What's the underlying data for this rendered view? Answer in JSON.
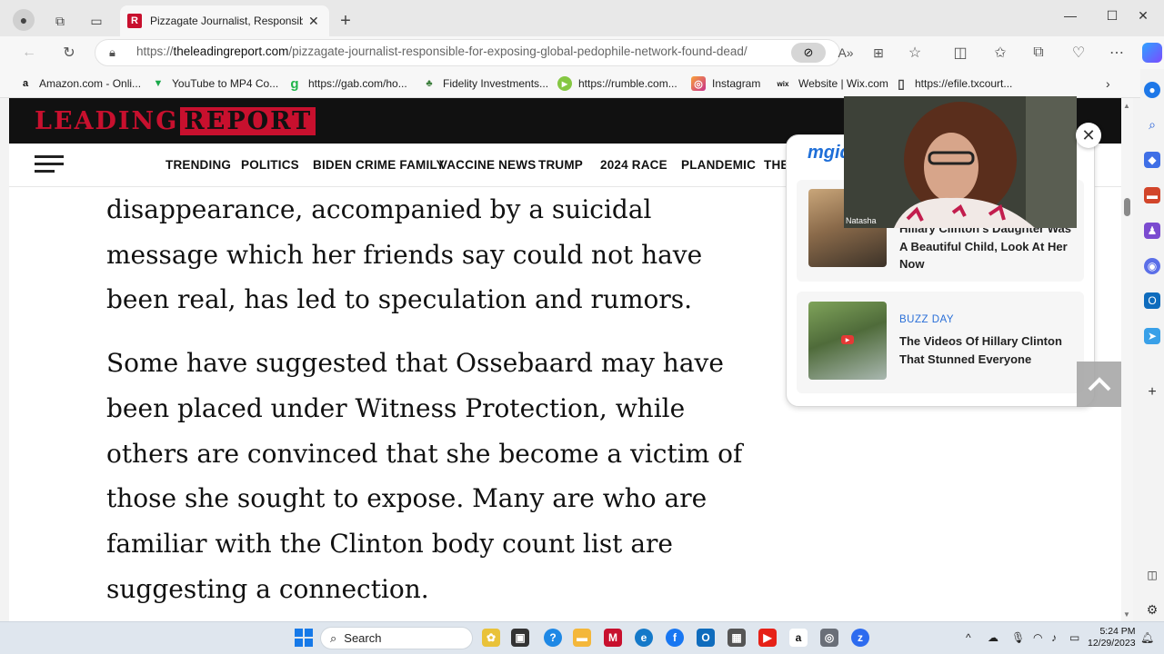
{
  "browser": {
    "tab_title": "Pizzagate Journalist, Responsible",
    "tab_favicon": "R",
    "url_prefix": "https://",
    "url_domain": "theleadingreport.com",
    "url_path": "/pizzagate-journalist-responsible-for-exposing-global-pedophile-network-found-dead/"
  },
  "favorites": [
    {
      "label": "Amazon.com - Onli...",
      "icon": "a"
    },
    {
      "label": "YouTube to MP4 Co...",
      "icon": "▼"
    },
    {
      "label": "https://gab.com/ho...",
      "icon": "g"
    },
    {
      "label": "Fidelity Investments...",
      "icon": "♣"
    },
    {
      "label": "https://rumble.com...",
      "icon": "▶"
    },
    {
      "label": "Instagram",
      "icon": "◎"
    },
    {
      "label": "Website | Wix.com",
      "icon": "wix"
    },
    {
      "label": "https://efile.txcourt...",
      "icon": "▯"
    }
  ],
  "site": {
    "logo_part1": "LEADING",
    "logo_part2": "REPORT",
    "nav": [
      "TRENDING",
      "POLITICS",
      "BIDEN CRIME FAMILY",
      "VACCINE NEWS",
      "TRUMP",
      "2024 RACE",
      "PLANDEMIC",
      "THE I"
    ]
  },
  "article": {
    "p1": "disappearance, accompanied by a suicidal message which her friends say could not have been real, has led to speculation and rumors.",
    "p2": "Some have suggested that Ossebaard may have been placed under Witness Protection, while others are convinced that she become a victim of those she sought to expose. Many are who are familiar with the Clinton body count list are suggesting a connection."
  },
  "ad": {
    "brand": "mgid",
    "cards": [
      {
        "source": "",
        "headline": "Hillary Clinton's Daughter Was A Beautiful Child, Look At Her Now"
      },
      {
        "source": "BUZZ DAY",
        "headline": "The Videos Of Hillary Clinton That Stunned Everyone"
      }
    ]
  },
  "video_overlay": {
    "name": "Natasha"
  },
  "taskbar": {
    "search_label": "Search",
    "time": "5:24 PM",
    "date": "12/29/2023"
  }
}
